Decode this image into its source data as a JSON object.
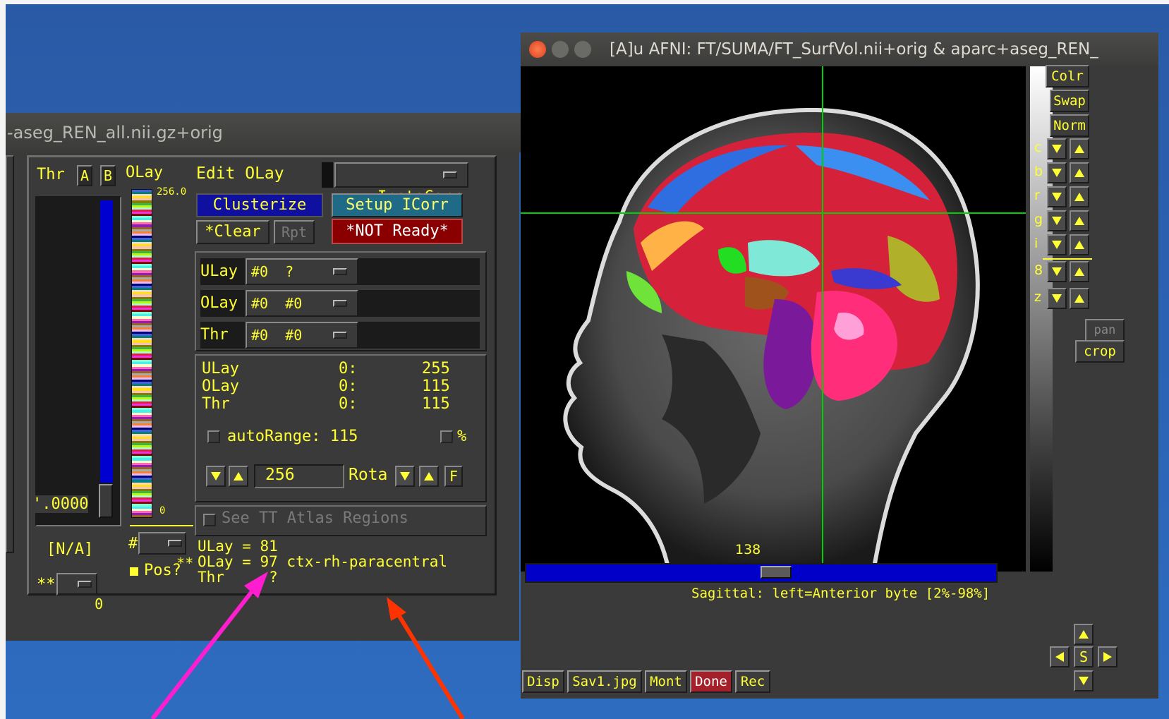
{
  "left_window": {
    "title": "-aseg_REN_all.nii.gz+orig",
    "thr_label": "Thr",
    "thr_A": "A",
    "thr_B": "B",
    "olay_label": "OLay",
    "colorbar_top": "256.0",
    "colorbar_bottom": "0",
    "thr_value": "'.0000",
    "thr_pvalue": "[N/A]",
    "stars_left": "**",
    "stars_value": "0",
    "hash_label": "#",
    "hash_value": "**",
    "pos_label": "Pos?",
    "edit_olay": "Edit OLay",
    "instacorr": "InstaCorr",
    "clusterize": "Clusterize",
    "setup_icorr": "Setup ICorr",
    "clear": "*Clear",
    "rpt": "Rpt",
    "not_ready": "*NOT Ready*",
    "selectors": [
      {
        "label": "ULay",
        "value": "#0  ?"
      },
      {
        "label": "OLay",
        "value": "#0  #0"
      },
      {
        "label": "Thr",
        "value": "#0  #0"
      }
    ],
    "ranges": [
      {
        "label": "ULay",
        "idx": "0:",
        "val": "255"
      },
      {
        "label": "OLay",
        "idx": "0:",
        "val": "115"
      },
      {
        "label": "Thr",
        "idx": "0:",
        "val": "115"
      }
    ],
    "autorange_label": "autoRange: 115",
    "percent_label": "%",
    "colors_count": "256",
    "rota_label": "Rota",
    "f_label": "F",
    "see_tt": "See TT Atlas Regions",
    "info": {
      "ulay": "ULay = 81",
      "olay": "OLay = 97 ctx-rh-paracentral",
      "thr": "Thr     ?"
    }
  },
  "right_window": {
    "title": "[A]u AFNI: FT/SUMA/FT_SurfVol.nii+orig & aparc+aseg_REN_",
    "side_buttons": [
      "Colr",
      "Swap",
      "Norm"
    ],
    "adjust_labels": [
      "c",
      "b",
      "r",
      "g",
      "i",
      "8",
      "z"
    ],
    "pan": "pan",
    "crop": "crop",
    "slice_number": "138",
    "orientation_text": "Sagittal: left=Anterior byte [2%-98%]",
    "bottom_buttons": [
      "Disp",
      "Sav1.jpg",
      "Mont",
      "Done",
      "Rec"
    ],
    "s_label": "S"
  },
  "colors": {
    "accent_yellow": "#ffff33",
    "window_bg": "#3a3a3a",
    "done_red": "#a4202a",
    "not_ready_red": "#8a0000",
    "clusterize_blue": "#1010a0",
    "setup_teal": "#1f6a86",
    "crosshair_green": "#00d000",
    "annotation_magenta": "#ff1ecf",
    "annotation_red": "#ff3300"
  }
}
